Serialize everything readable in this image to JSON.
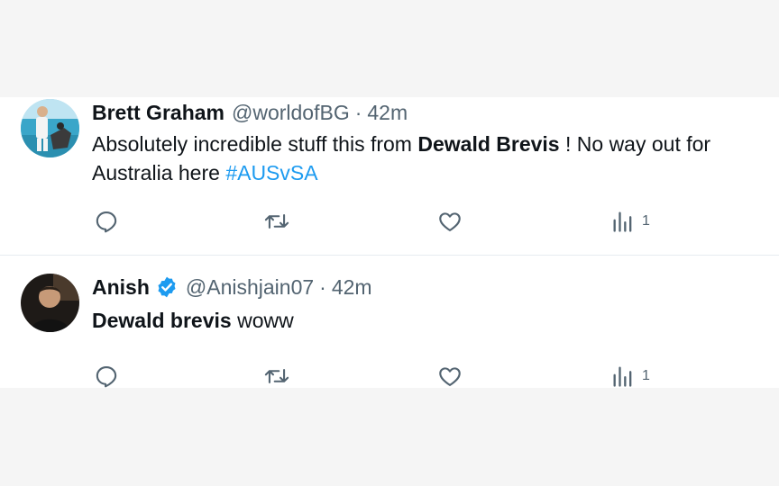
{
  "tweets": [
    {
      "name": "Brett Graham",
      "handle": "@worldofBG",
      "separator": "·",
      "time": "42m",
      "verified": false,
      "avatar": "person-on-beach-photo",
      "text_parts": [
        {
          "text": "Absolutely incredible stuff this from ",
          "style": "normal"
        },
        {
          "text": "Dewald Brevis",
          "style": "bold"
        },
        {
          "text": " ! No way out for Australia here ",
          "style": "normal"
        },
        {
          "text": "#AUSvSA",
          "style": "hashtag"
        }
      ],
      "views": "1"
    },
    {
      "name": "Anish",
      "handle": "@Anishjain07",
      "separator": "·",
      "time": "42m",
      "verified": true,
      "avatar": "person-portrait-photo",
      "text_parts": [
        {
          "text": "Dewald brevis",
          "style": "bold"
        },
        {
          "text": " woww",
          "style": "normal"
        }
      ],
      "views": "1"
    }
  ],
  "icons": {
    "reply": "reply-icon",
    "retweet": "retweet-icon",
    "like": "like-icon",
    "views": "views-icon",
    "verified": "verified-badge-icon"
  },
  "colors": {
    "page_background": "#f5f5f5",
    "card_background": "#ffffff",
    "text_primary": "#0f1419",
    "text_secondary": "#536471",
    "hashtag": "#1d9bf0",
    "verified": "#1d9bf0",
    "divider": "#e6ecf0"
  }
}
